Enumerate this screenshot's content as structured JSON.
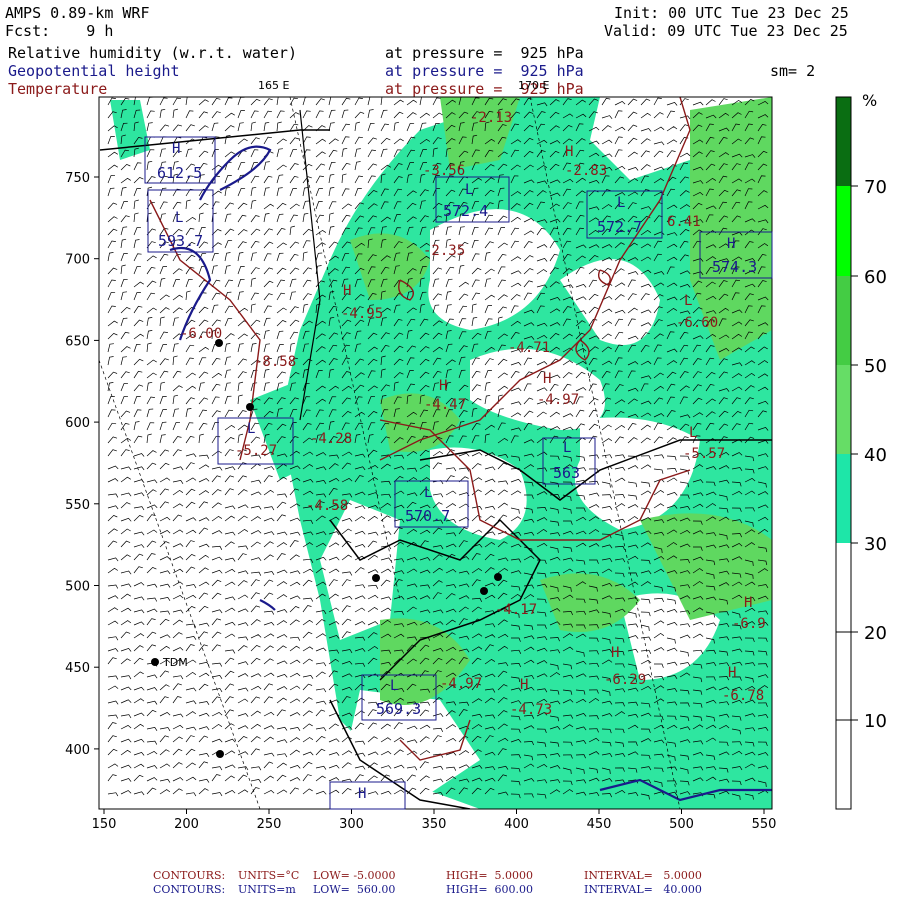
{
  "header": {
    "model": "AMPS 0.89-km WRF",
    "forecast_label": "Fcst:",
    "forecast_hours": "9 h",
    "init": "Init: 00 UTC Tue 23 Dec 25",
    "valid": "Valid: 09 UTC Tue 23 Dec 25",
    "fields": [
      {
        "name": "Relative humidity (w.r.t. water)",
        "level": "at pressure =  925 hPa",
        "color": "#000000"
      },
      {
        "name": "Geopotential height",
        "level": "at pressure =  925 hPa",
        "color": "#1a1a8b"
      },
      {
        "name": "Temperature",
        "level": "at pressure =  925 hPa",
        "color": "#8b1a1a"
      }
    ],
    "smoothing": "sm= 2",
    "lon_165": "165 E",
    "lon_170": "170 E"
  },
  "colorbar": {
    "unit": "%",
    "ticks": [
      "70",
      "60",
      "50",
      "40",
      "30",
      "20",
      "10"
    ],
    "colors": [
      "#0a6e12",
      "#00ff00",
      "#44cc44",
      "#66dd66",
      "#1ee6a8",
      "#ffffff",
      "#ffffff",
      "#ffffff"
    ]
  },
  "axes": {
    "x_ticks": [
      "150",
      "200",
      "250",
      "300",
      "350",
      "400",
      "450",
      "500",
      "550"
    ],
    "y_ticks": [
      "750",
      "700",
      "650",
      "600",
      "550",
      "500",
      "450",
      "400"
    ]
  },
  "stations": {
    "tdm": "TDM"
  },
  "labels": {
    "highs": [
      "H",
      "H",
      "H",
      "H",
      "H",
      "H",
      "H",
      "H",
      "H",
      "H",
      "H"
    ],
    "lows": [
      "L",
      "L",
      "L",
      "L",
      "L",
      "L",
      "L",
      "L",
      "L"
    ],
    "values": [
      "-2.13",
      "-2.83",
      "-3.56",
      "-2.35",
      "6.41",
      "-4.95",
      "-6.60",
      "-8.58",
      "-4.71",
      "-4.47",
      "-4.97",
      "-4.28",
      "-5.57",
      "-4.58",
      "-4.17",
      "-6.9",
      "-6.29",
      "-6.78",
      "-4.73",
      "-5.27",
      "-4.97",
      "-6.00"
    ],
    "boxes": [
      "612.5",
      "572.4",
      "572.7",
      "574.3",
      "593.7",
      "563",
      "570.7",
      "569.3"
    ]
  },
  "footer": {
    "temp": {
      "label": "CONTOURS:",
      "units": "UNITS=°C",
      "low": "LOW= -5.0000",
      "high": "HIGH=  5.0000",
      "interval": "INTERVAL=   5.0000"
    },
    "height": {
      "label": "CONTOURS:",
      "units": "UNITS=m",
      "low": "LOW=  560.00",
      "high": "HIGH=  600.00",
      "interval": "INTERVAL=   40.000"
    }
  }
}
